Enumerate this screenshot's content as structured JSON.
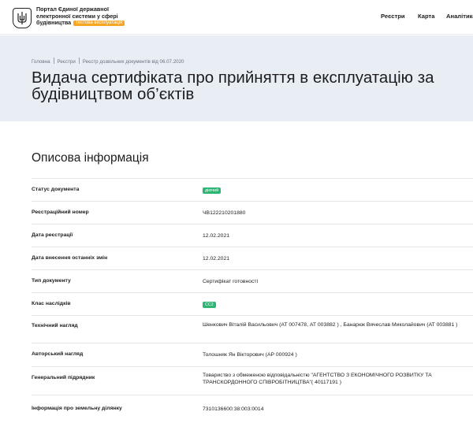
{
  "header": {
    "brand_line1": "Портал Єдиної державної",
    "brand_line2": "електронної системи у сфері",
    "brand_line3": "будівництва",
    "beta_label": "тестова експлуатація",
    "nav": [
      "Реєстри",
      "Карта",
      "Аналітика"
    ]
  },
  "breadcrumbs": [
    "Головна",
    "Реєстри",
    "Реєстр дозвільних документів від 06.07.2020"
  ],
  "page_title_line1": "Видача сертифіката про прийняття в експлуатацію за",
  "page_title_line2": "будівництвом об’єктів",
  "section_title": "Описова інформація",
  "rows": [
    {
      "label": "Статус документа",
      "value": "діючий",
      "badge": true
    },
    {
      "label": "Реєстраційний номер",
      "value": "ЧВ122210201880"
    },
    {
      "label": "Дата реєстрації",
      "value": "12.02.2021"
    },
    {
      "label": "Дата внесення останніх змін",
      "value": "12.02.2021"
    },
    {
      "label": "Тип документу",
      "value": "Сертифікат готовності"
    },
    {
      "label": "Клас наслідків",
      "value": "СС2",
      "badge": true
    },
    {
      "label": "Технічний нагляд",
      "value": "Шенкович Віталій Васильович (АТ 007478, АТ 003882 ) , Банарюк Вячеслав Миколайович (АТ 003881 )"
    },
    {
      "label": "Авторський нагляд",
      "value": "Толошняк Ян Вікторович (АР 000924 )"
    },
    {
      "label": "Генеральний підрядник",
      "value": "Товариство з обмеженою відповідальністю \"АГЕНТСТВО З ЕКОНОМІЧНОГО РОЗВИТКУ ТА ТРАНСКОРДОННОГО СПІВРОБІТНИЦТВА\"( 40117191 )"
    },
    {
      "label": "Інформація про земельну ділянку",
      "value": "7310136600:38:003:0014"
    }
  ],
  "colors": {
    "hero_bg": "#e9eef4",
    "badge_green": "#2bb673",
    "beta_orange": "#f5a623"
  }
}
